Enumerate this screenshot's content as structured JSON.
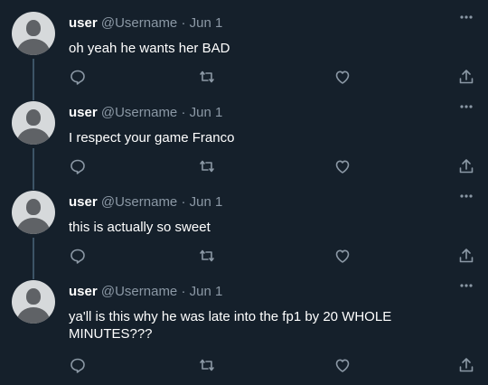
{
  "tweets": [
    {
      "name": "user",
      "handle": "@Username",
      "separator": "·",
      "date": "Jun 1",
      "text": "oh yeah he wants her BAD"
    },
    {
      "name": "user",
      "handle": "@Username",
      "separator": "·",
      "date": "Jun 1",
      "text": "I respect your game Franco"
    },
    {
      "name": "user",
      "handle": "@Username",
      "separator": "·",
      "date": "Jun 1",
      "text": "this is actually so sweet"
    },
    {
      "name": "user",
      "handle": "@Username",
      "separator": "·",
      "date": "Jun 1",
      "text": "ya'll is this why he was late into the fp1 by 20 WHOLE MINUTES???"
    }
  ],
  "icons": {
    "reply": "reply-icon",
    "retweet": "retweet-icon",
    "like": "heart-icon",
    "share": "share-icon",
    "more": "more-icon",
    "avatar": "avatar"
  },
  "colors": {
    "background": "#15202b",
    "text": "#ffffff",
    "muted": "#8b98a5",
    "thread_line": "#3d5466",
    "avatar_bg": "#d6d9db",
    "avatar_fg": "#5f6266"
  }
}
